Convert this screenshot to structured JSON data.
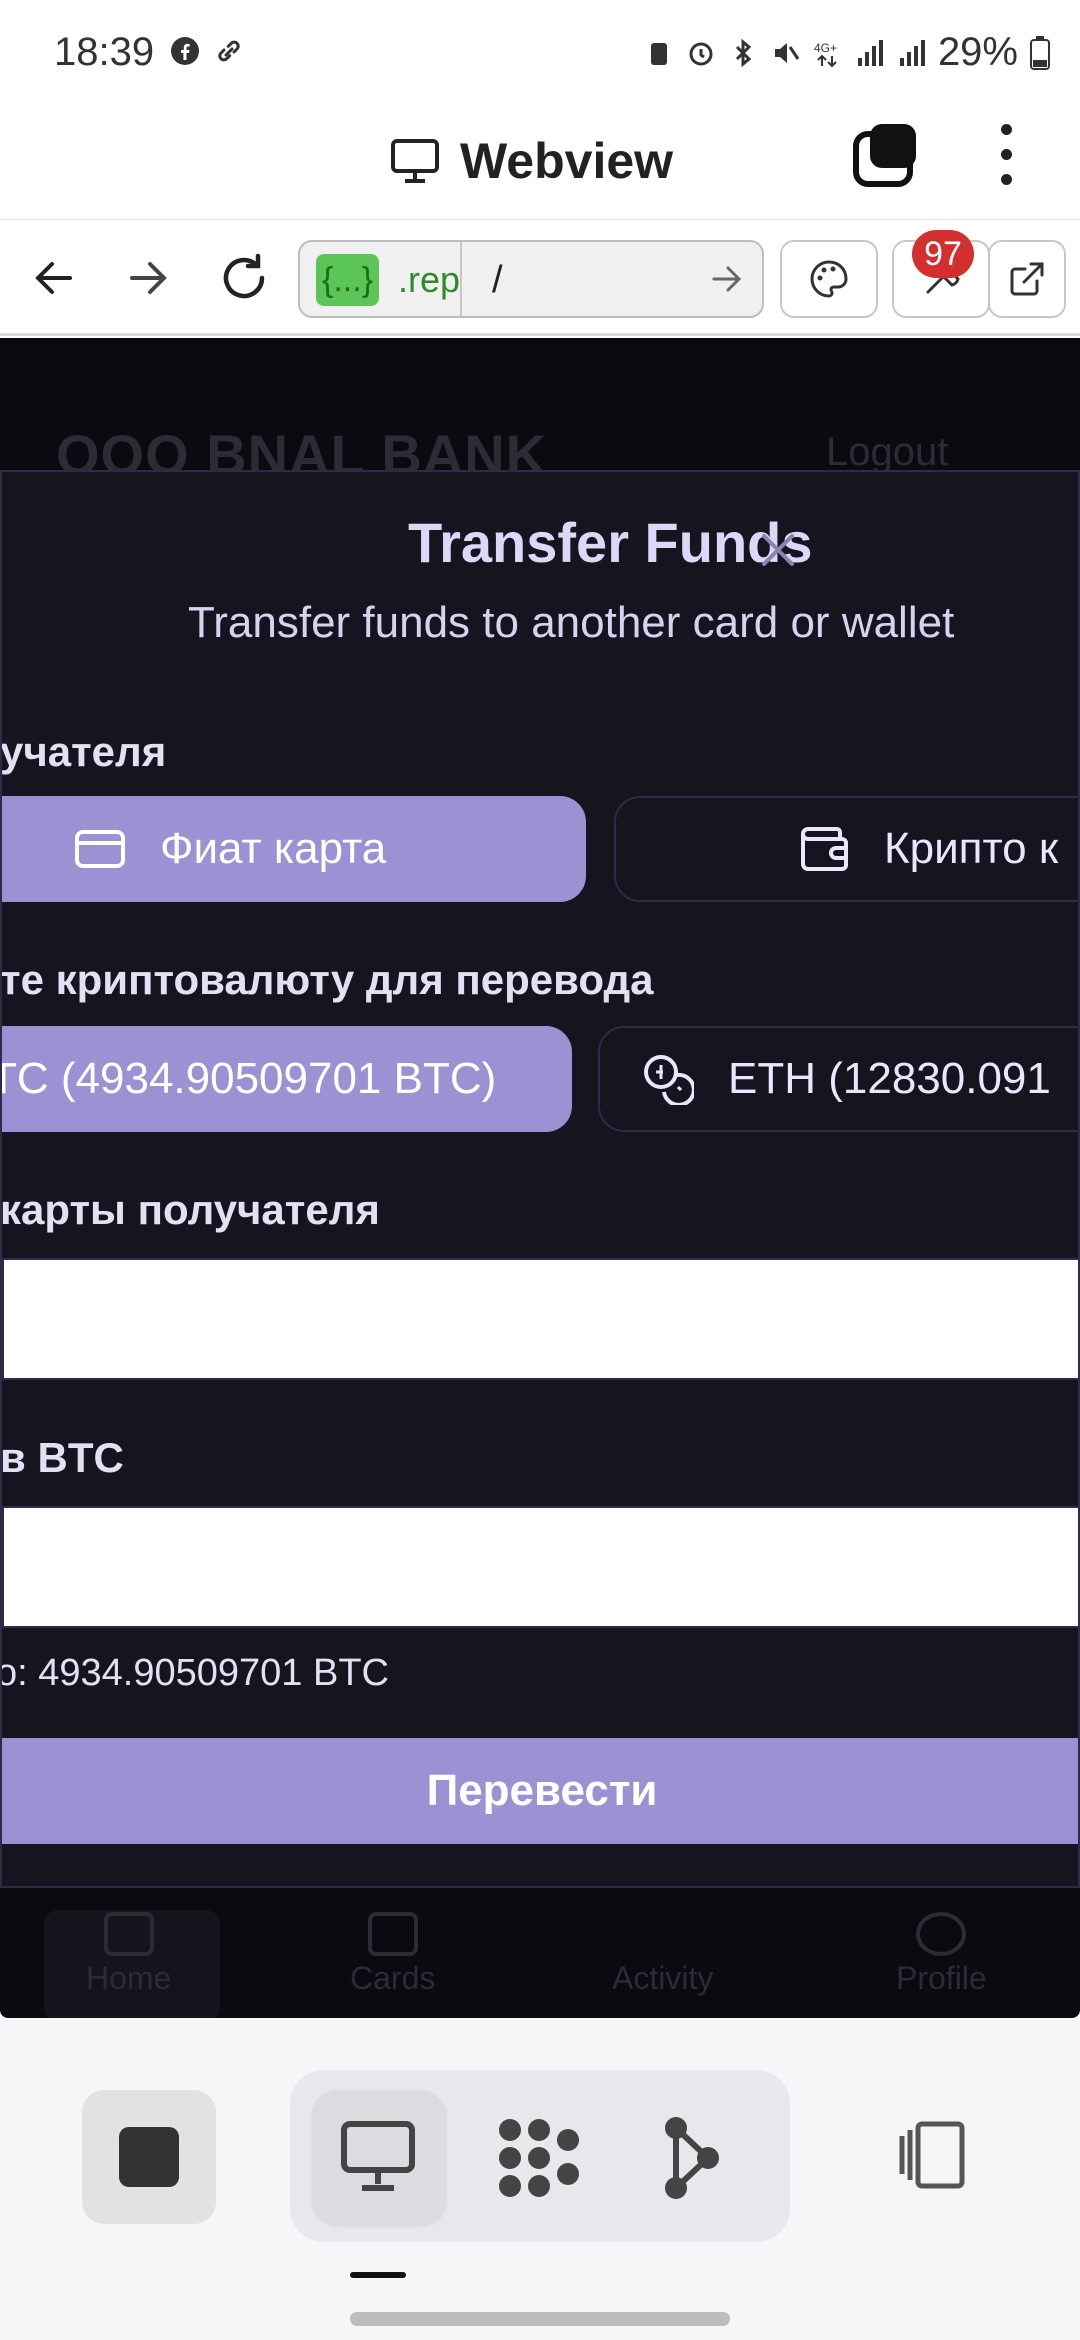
{
  "status_bar": {
    "time": "18:39",
    "battery": "29%",
    "net": "4G+"
  },
  "header": {
    "title": "Webview",
    "icons": [
      "monitor-icon",
      "tabs-icon",
      "kebab-menu-icon"
    ]
  },
  "browser": {
    "url_badge": "{...}",
    "url_domain": ".rep",
    "url_path": "/",
    "extensions_badge": "97"
  },
  "background_page": {
    "bank_name": "ООО BNAL BANK",
    "logout": "Logout",
    "nav": [
      "Home",
      "Cards",
      "Activity",
      "Profile"
    ]
  },
  "modal": {
    "title": "Transfer Funds",
    "subtitle": "Transfer funds to another card or wallet",
    "recipient_type_label": "учателя",
    "recipient_options": [
      "Фиат карта",
      "Крипто к"
    ],
    "crypto_label": "те криптовалюту для перевода",
    "crypto_options": [
      "ТС (4934.90509701 BTC)",
      "ETH (12830.091"
    ],
    "card_label": "карты получателя",
    "card_value": "",
    "amount_label": "в BTC",
    "amount_value": "",
    "available": "о: 4934.90509701 BTC",
    "submit": "Перевести"
  },
  "colors": {
    "accent": "#9b91d3",
    "modal_bg": "#16141f",
    "page_bg": "#0b0a10"
  }
}
